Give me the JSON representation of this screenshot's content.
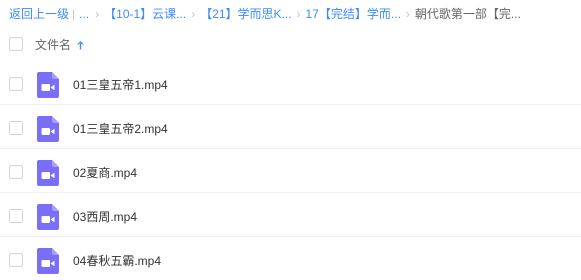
{
  "breadcrumb": {
    "back_label": "返回上一级",
    "separator": "|",
    "more": "...",
    "items": [
      "【10-1】云课...",
      "【21】学而思K...",
      "17【完结】学而..."
    ],
    "current": "朝代歌第一部【完..."
  },
  "header": {
    "column_name": "文件名",
    "sort_icon": "arrow-up-icon"
  },
  "files": [
    {
      "name": "01三皇五帝1.mp4",
      "icon": "video-file-icon"
    },
    {
      "name": "01三皇五帝2.mp4",
      "icon": "video-file-icon"
    },
    {
      "name": "02夏商.mp4",
      "icon": "video-file-icon"
    },
    {
      "name": "03西周.mp4",
      "icon": "video-file-icon"
    },
    {
      "name": "04春秋五霸.mp4",
      "icon": "video-file-icon"
    }
  ],
  "colors": {
    "link": "#3b8cff",
    "video_icon": "#7b6ef6"
  }
}
